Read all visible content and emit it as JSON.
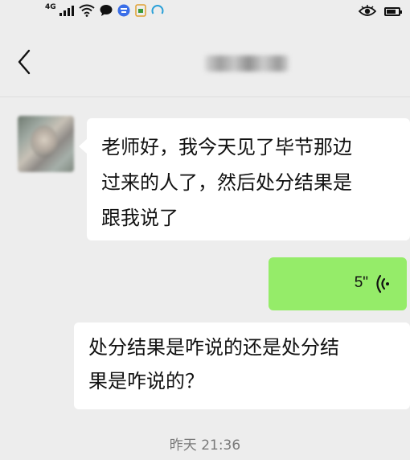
{
  "status_bar": {
    "network_type": "4G",
    "icons": [
      "signal-bars-icon",
      "wifi-icon",
      "chat-bubble-icon",
      "app-icon",
      "sim-icon",
      "loading-arc-icon",
      "eye-icon",
      "battery-icon"
    ]
  },
  "header": {
    "title": "",
    "back_icon": "chevron-left-icon"
  },
  "messages": [
    {
      "direction": "incoming",
      "type": "text",
      "text": "老师好，我今天见了毕节那边\n过来的人了，然后处分结果是\n跟我说了"
    },
    {
      "direction": "outgoing",
      "type": "voice",
      "duration": "5\""
    },
    {
      "direction": "incoming",
      "type": "text",
      "text": "处分结果是咋说的还是处分结\n果是咋说的？"
    }
  ],
  "timestamp": "昨天 21:36",
  "colors": {
    "background": "#ededed",
    "incoming_bubble": "#ffffff",
    "outgoing_bubble": "#95ec69",
    "timestamp_text": "#7a7a7a"
  }
}
